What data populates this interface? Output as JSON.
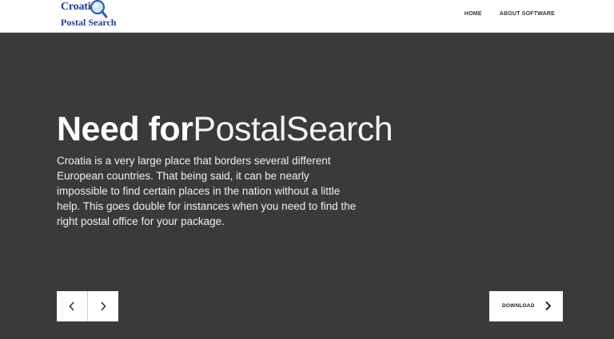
{
  "logo": {
    "line1": "Croatia",
    "line2": "Postal Search",
    "icon": "magnifying-glass-icon"
  },
  "nav": {
    "items": [
      {
        "label": "HOME"
      },
      {
        "label": "ABOUT SOFTWARE"
      }
    ]
  },
  "hero": {
    "title_bold": "Need for",
    "title_light": "PostalSearch",
    "text": "Croatia is a very large place that borders several different European countries. That being said, it can be nearly impossible to find certain places in the nation without a little help. This goes double for instances when you need to find the right postal office for your package."
  },
  "slider": {
    "prev_icon": "chevron-left-icon",
    "next_icon": "chevron-right-icon"
  },
  "download": {
    "label": "DOWNLOAD",
    "icon": "chevron-right-icon"
  },
  "colors": {
    "hero_bg": "#3a3a3a",
    "logo_blue": "#1f3f8f",
    "nav_text": "#333333"
  }
}
